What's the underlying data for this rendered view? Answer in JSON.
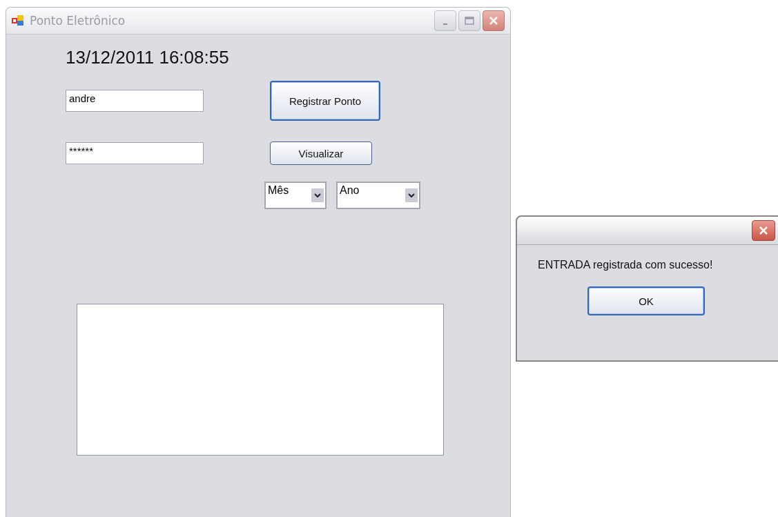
{
  "window": {
    "title": "Ponto Eletrônico",
    "controls": [
      {
        "kind": "minimize",
        "disabled": true
      },
      {
        "kind": "maximize",
        "disabled": true
      },
      {
        "kind": "close",
        "disabled": true
      }
    ]
  },
  "clock": "13/12/2011 16:08:55",
  "user_field": {
    "value": "andre"
  },
  "password_field": {
    "value": "******"
  },
  "buttons": [
    {
      "label": "Registrar Ponto",
      "default": true
    },
    {
      "label": "Visualizar",
      "default": false
    }
  ],
  "dropdowns": [
    {
      "value": "Mês"
    },
    {
      "value": "Ano"
    }
  ],
  "dialog": {
    "message": "ENTRADA registrada com sucesso!",
    "button": {
      "label": "OK",
      "default": true
    }
  }
}
